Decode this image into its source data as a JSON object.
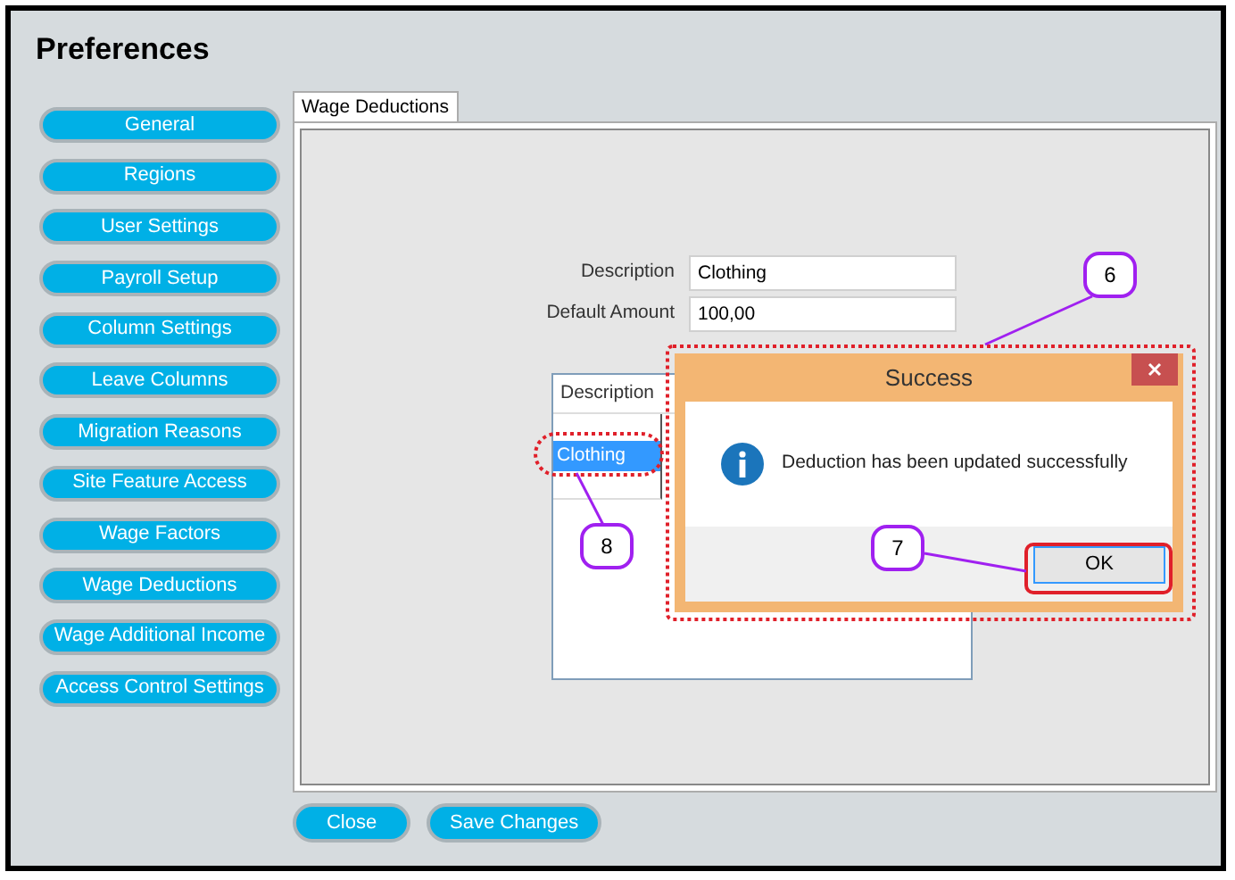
{
  "window": {
    "title": "Preferences"
  },
  "sidebar": {
    "items": [
      {
        "label": "General"
      },
      {
        "label": "Regions"
      },
      {
        "label": "User Settings"
      },
      {
        "label": "Payroll Setup"
      },
      {
        "label": "Column Settings"
      },
      {
        "label": "Leave Columns"
      },
      {
        "label": "Migration Reasons"
      },
      {
        "label": "Site Feature Access"
      },
      {
        "label": "Wage Factors"
      },
      {
        "label": "Wage Deductions"
      },
      {
        "label": "Wage Additional Income"
      },
      {
        "label": "Access Control Settings"
      }
    ]
  },
  "tabs": [
    {
      "label": "Wage Deductions",
      "selected": true
    }
  ],
  "form": {
    "fields": [
      {
        "label": "Description",
        "value": "Clothing"
      },
      {
        "label": "Default Amount",
        "value": "100,00"
      }
    ]
  },
  "table": {
    "columns": [
      "Description"
    ],
    "rows": [
      {
        "cells": [
          "Clothing"
        ],
        "selected": true
      }
    ]
  },
  "dialog": {
    "title": "Success",
    "message": "Deduction has been updated successfully",
    "button": "OK"
  },
  "annotations": [
    {
      "label": "6"
    },
    {
      "label": "7"
    },
    {
      "label": "8"
    }
  ],
  "buttons": [
    {
      "label": "Close"
    },
    {
      "label": "Save Changes"
    }
  ]
}
